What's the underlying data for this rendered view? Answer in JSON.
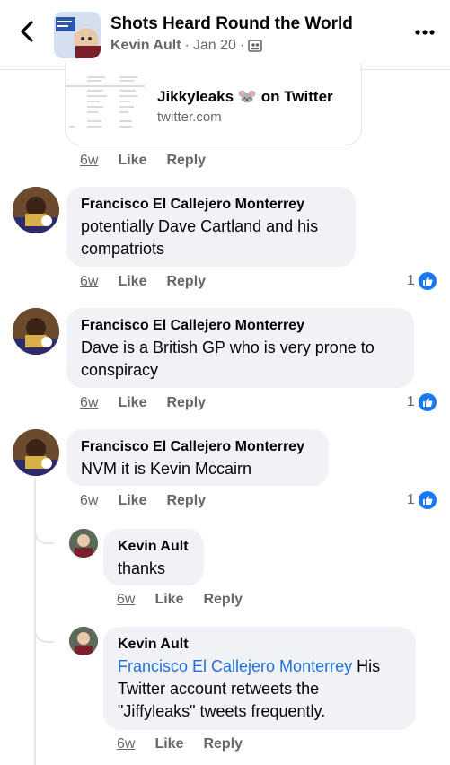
{
  "header": {
    "title": "Shots Heard Round the World",
    "author": "Kevin Ault",
    "separator": "·",
    "date": "Jan 20",
    "separator2": "·",
    "icons": [
      "back-chevron-icon",
      "group-icon",
      "more-options-icon"
    ]
  },
  "link_preview": {
    "title": "Jikkyleaks 🐭 on Twitter",
    "domain": "twitter.com",
    "actions": {
      "time": "6w",
      "like": "Like",
      "reply": "Reply"
    }
  },
  "comments": [
    {
      "name": "Francisco El Callejero Monterrey",
      "text_line1": "potentially Dave Cartland and his",
      "text_line2": "compatriots",
      "time": "6w",
      "like": "Like",
      "reply": "Reply",
      "reactions": "1"
    },
    {
      "name": "Francisco El Callejero Monterrey",
      "text_line1": "Dave is a British GP who is very prone to",
      "text_line2": "conspiracy",
      "time": "6w",
      "like": "Like",
      "reply": "Reply",
      "reactions": "1"
    },
    {
      "name": "Francisco El Callejero Monterrey",
      "text_line1": "NVM it is Kevin Mccairn",
      "time": "6w",
      "like": "Like",
      "reply": "Reply",
      "reactions": "1"
    }
  ],
  "replies": [
    {
      "name": "Kevin Ault",
      "text": "thanks",
      "time": "6w",
      "like": "Like",
      "reply": "Reply"
    },
    {
      "name": "Kevin Ault",
      "mention": "Francisco El Callejero Monterrey",
      "text_line1_rest": " His",
      "text_line2": "Twitter account retweets the",
      "text_line3": "\"Jiffyleaks\" tweets frequently.",
      "time": "6w",
      "like": "Like",
      "reply": "Reply"
    }
  ],
  "colors": {
    "accent": "#1877f2",
    "mention": "#216fdb",
    "bubble": "#f0f2f5",
    "meta": "#65676b"
  }
}
